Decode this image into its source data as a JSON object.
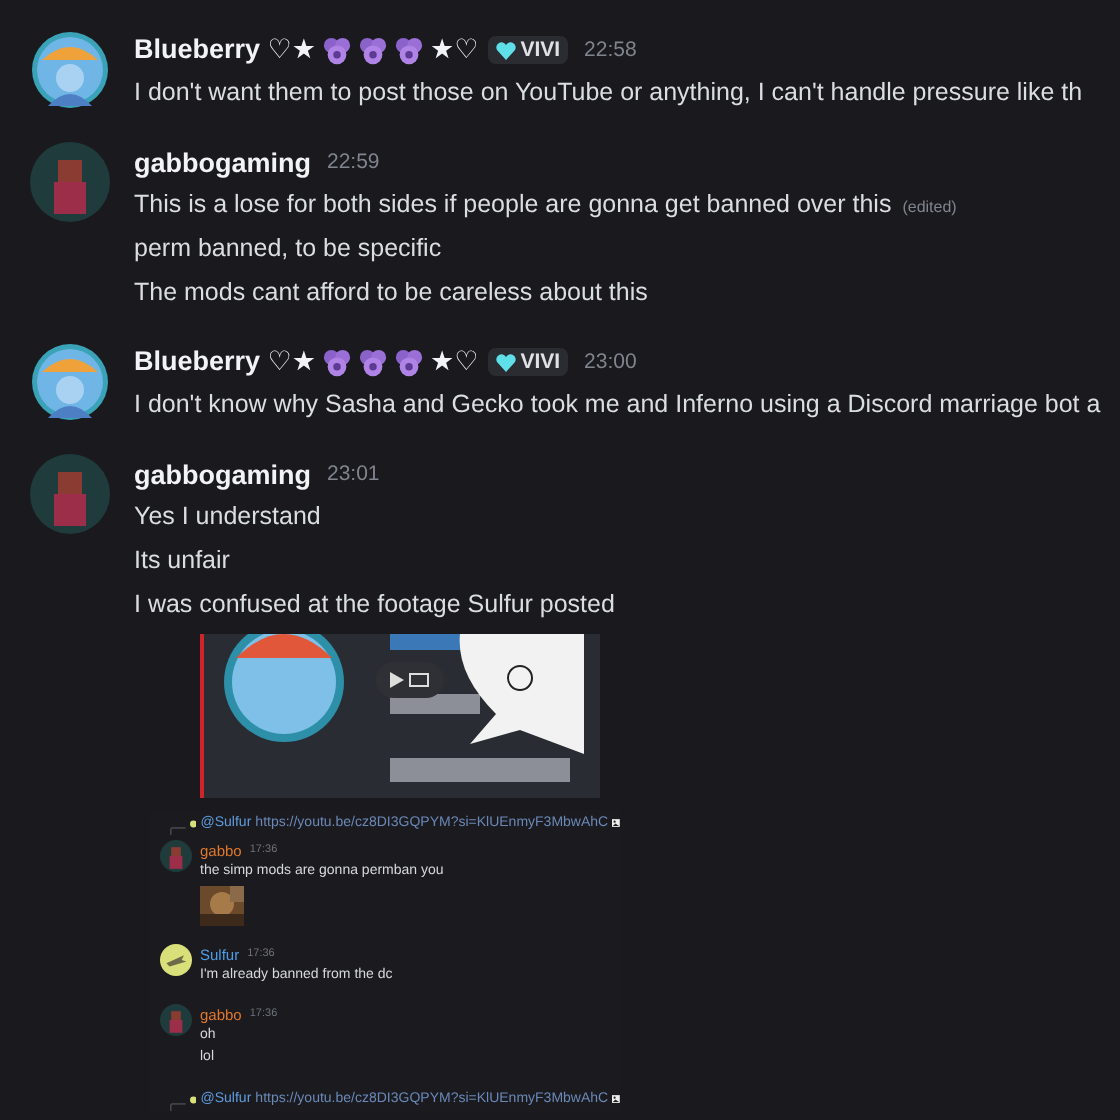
{
  "messages": [
    {
      "author": "Blueberry ♡★",
      "author_emojis": [
        {
          "kind": "grape"
        },
        {
          "kind": "grape"
        },
        {
          "kind": "grape"
        }
      ],
      "author_suffix": "★♡",
      "tag": "VIVI",
      "time": "22:58",
      "avatar": {
        "kind": "ringed"
      },
      "lines": [
        {
          "text": "I don't want them to post those on YouTube or anything, I can't handle pressure like th"
        }
      ]
    },
    {
      "author": "gabbogaming",
      "time": "22:59",
      "avatar": {
        "kind": "figure"
      },
      "lines": [
        {
          "text": "This is a lose for both sides if people are gonna get banned over this",
          "edited": "(edited)"
        },
        {
          "text": "perm banned, to be specific"
        },
        {
          "text": "The mods cant afford to be careless about this"
        }
      ]
    },
    {
      "author": "Blueberry ♡★",
      "author_emojis": [
        {
          "kind": "grape"
        },
        {
          "kind": "grape"
        },
        {
          "kind": "grape"
        }
      ],
      "author_suffix": "★♡",
      "tag": "VIVI",
      "time": "23:00",
      "avatar": {
        "kind": "ringed"
      },
      "lines": [
        {
          "text": "I don't know why Sasha and Gecko took me and Inferno using a Discord marriage bot a"
        }
      ]
    },
    {
      "author": "gabbogaming",
      "time": "23:01",
      "avatar": {
        "kind": "figure"
      },
      "lines": [
        {
          "text": "Yes I understand"
        },
        {
          "text": "Its unfair"
        },
        {
          "text": "I was confused at the footage Sulfur posted"
        }
      ],
      "attachments": [
        {
          "kind": "video"
        },
        {
          "kind": "screenshot",
          "items": [
            {
              "kind": "reply",
              "mention": "@Sulfur",
              "link": "https://youtu.be/cz8DI3GQPYM?si=KlUEnmyF3MbwAhC"
            },
            {
              "kind": "message",
              "author": "gabbo",
              "color": "#e0772c",
              "time": "17:36",
              "avatar": {
                "kind": "figure"
              },
              "lines": [
                "the simp mods are gonna permban you"
              ],
              "image": {
                "kind": "picture"
              }
            },
            {
              "kind": "message",
              "author": "Sulfur",
              "color": "#4f9ce8",
              "time": "17:36",
              "avatar": {
                "kind": "plane"
              },
              "lines": [
                "I'm already banned from the dc"
              ]
            },
            {
              "kind": "message",
              "author": "gabbo",
              "color": "#e0772c",
              "time": "17:36",
              "avatar": {
                "kind": "figure"
              },
              "lines": [
                "oh",
                "lol"
              ]
            },
            {
              "kind": "reply",
              "mention": "@Sulfur",
              "link": "https://youtu.be/cz8DI3GQPYM?si=KlUEnmyF3MbwAhC"
            }
          ]
        }
      ]
    }
  ]
}
